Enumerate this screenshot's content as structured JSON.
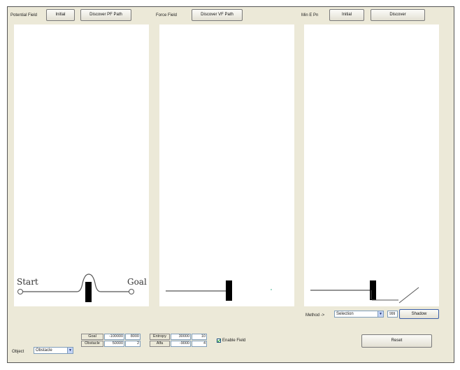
{
  "panel1": {
    "label": "Potential Field",
    "init": "Initial",
    "discover": "Discover PF Path",
    "start": "Start",
    "goal": "Goal"
  },
  "panel2": {
    "label": "Force Field",
    "discover": "Discover VF Path"
  },
  "panel3": {
    "label": "Min E Pn",
    "init": "Initial",
    "discover": "Discover"
  },
  "method": {
    "label": "Method ->",
    "value": "Selection",
    "value_field": "999",
    "button": "Shadow"
  },
  "object": {
    "label": "Object",
    "value": "Obstacle"
  },
  "grid1": {
    "rows": [
      [
        "Goal",
        "-100000",
        "8000"
      ],
      [
        "Obstacle",
        "50000",
        "2"
      ]
    ]
  },
  "grid2": {
    "rows": [
      [
        "Entropy",
        "30000",
        "10"
      ],
      [
        "Alfa",
        "-9000",
        "4"
      ]
    ]
  },
  "enable_label": "Enable Field",
  "enable_checked": true,
  "reset": "Reset",
  "colors": {
    "frame": "#ece9d8",
    "panel": "#ffffff",
    "obstacle": "#000000",
    "line": "#555555"
  }
}
